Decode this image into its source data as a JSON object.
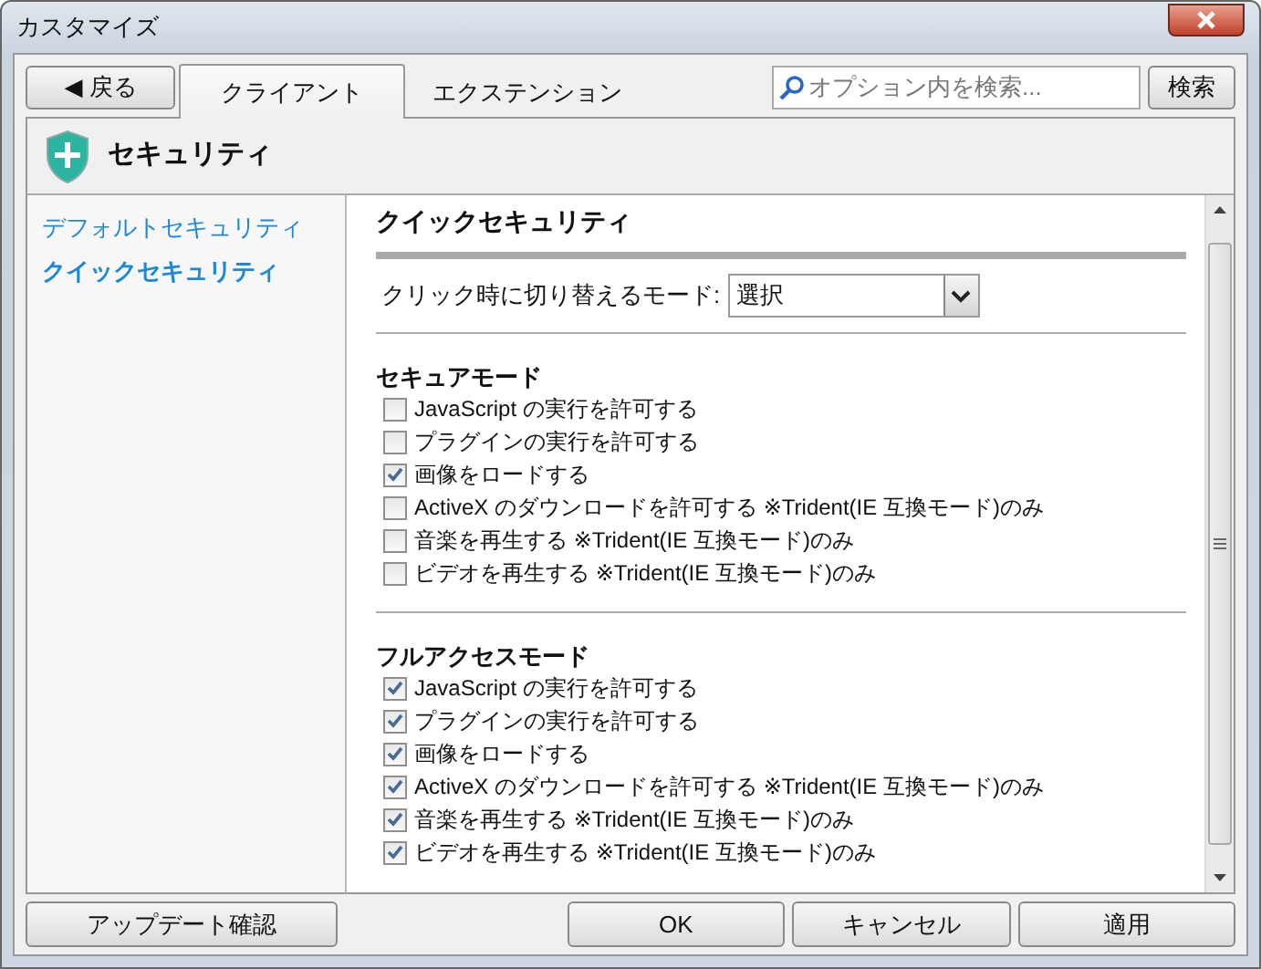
{
  "window": {
    "title": "カスタマイズ"
  },
  "back_button": "◀ 戻る",
  "tabs": [
    {
      "label": "クライアント",
      "selected": true
    },
    {
      "label": "エクステンション",
      "selected": false
    }
  ],
  "search": {
    "placeholder": "オプション内を検索...",
    "button": "検索"
  },
  "section_title": "セキュリティ",
  "sidebar": {
    "items": [
      {
        "label": "デフォルトセキュリティ",
        "selected": false
      },
      {
        "label": "クイックセキュリティ",
        "selected": true
      }
    ]
  },
  "panel": {
    "title": "クイックセキュリティ",
    "mode_label": "クリック時に切り替えるモード:",
    "mode_value": "選択",
    "groups": [
      {
        "title": "セキュアモード",
        "options": [
          {
            "label": "JavaScript の実行を許可する",
            "checked": false
          },
          {
            "label": "プラグインの実行を許可する",
            "checked": false
          },
          {
            "label": "画像をロードする",
            "checked": true
          },
          {
            "label": "ActiveX のダウンロードを許可する ※Trident(IE 互換モード)のみ",
            "checked": false
          },
          {
            "label": "音楽を再生する ※Trident(IE 互換モード)のみ",
            "checked": false
          },
          {
            "label": "ビデオを再生する ※Trident(IE 互換モード)のみ",
            "checked": false
          }
        ]
      },
      {
        "title": "フルアクセスモード",
        "options": [
          {
            "label": "JavaScript の実行を許可する",
            "checked": true
          },
          {
            "label": "プラグインの実行を許可する",
            "checked": true
          },
          {
            "label": "画像をロードする",
            "checked": true
          },
          {
            "label": "ActiveX のダウンロードを許可する ※Trident(IE 互換モード)のみ",
            "checked": true
          },
          {
            "label": "音楽を再生する ※Trident(IE 互換モード)のみ",
            "checked": true
          },
          {
            "label": "ビデオを再生する ※Trident(IE 互換モード)のみ",
            "checked": true
          }
        ]
      }
    ]
  },
  "buttons": {
    "update": "アップデート確認",
    "ok": "OK",
    "cancel": "キャンセル",
    "apply": "適用"
  }
}
